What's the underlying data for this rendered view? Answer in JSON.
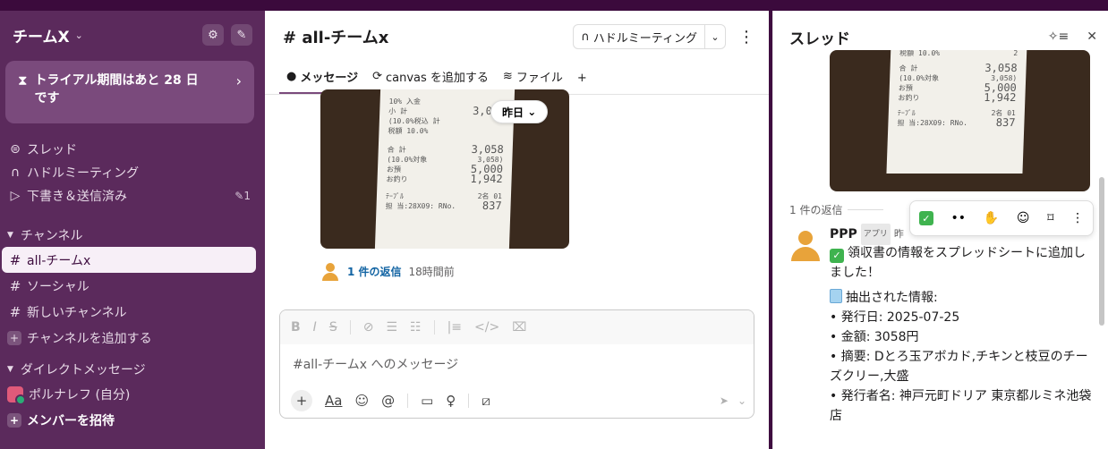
{
  "sidebar": {
    "workspace": "チームX",
    "trial": "トライアル期間はあと 28 日です",
    "nav": [
      {
        "label": "スレッド",
        "icon": "thread-icon"
      },
      {
        "label": "ハドルミーティング",
        "icon": "headphones-icon"
      },
      {
        "label": "下書き＆送信済み",
        "icon": "send-icon",
        "count": "1"
      }
    ],
    "channels_section": "チャンネル",
    "channels": [
      "all-チームx",
      "ソーシャル",
      "新しいチャンネル"
    ],
    "add_channel": "チャンネルを追加する",
    "dm_section": "ダイレクトメッセージ",
    "dm_self": "ポルナレフ (自分)",
    "invite": "メンバーを招待"
  },
  "channel": {
    "title": "# all-チームx",
    "huddle": "ハドルミーティング",
    "tabs": [
      "メッセージ",
      "canvas を追加する",
      "ファイル"
    ],
    "date_pill": "昨日",
    "reply_link": "1 件の返信",
    "reply_time": "18時間前",
    "composer_placeholder": "#all-チームx へのメッセージ"
  },
  "receipt_text": {
    "line1": "10% 入金",
    "line2": "小 計",
    "v2": "3,058",
    "line3": "(10.0%税込 計",
    "v3": "2",
    "line4": "税額 10.0%",
    "line5": "合 計",
    "v5": "3,058",
    "line6": "(10.0%対象",
    "v6": "3,058)",
    "line7": "お預",
    "v7": "5,000",
    "line8": "お釣り",
    "v8": "1,942",
    "line9": "ﾃｰﾌﾞﾙ",
    "v9": "2名 01",
    "line10": "担 当:28X09: RNo.",
    "v10": "837"
  },
  "thread": {
    "title": "スレッド",
    "reply_count": "1 件の返信",
    "name": "PPP",
    "badge": "アプリ",
    "time": "昨",
    "line1": "領収書の情報をスプレッドシートに追加しました！",
    "extracted": "抽出された情報:",
    "items": [
      "• 発行日: 2025-07-25",
      "• 金額: 3058円",
      "• 摘要: Dとろ玉アボカド,チキンと枝豆のチーズクリー,大盛",
      "• 発行者名: 神戸元町ドリア 東京都ルミネ池袋店"
    ]
  }
}
